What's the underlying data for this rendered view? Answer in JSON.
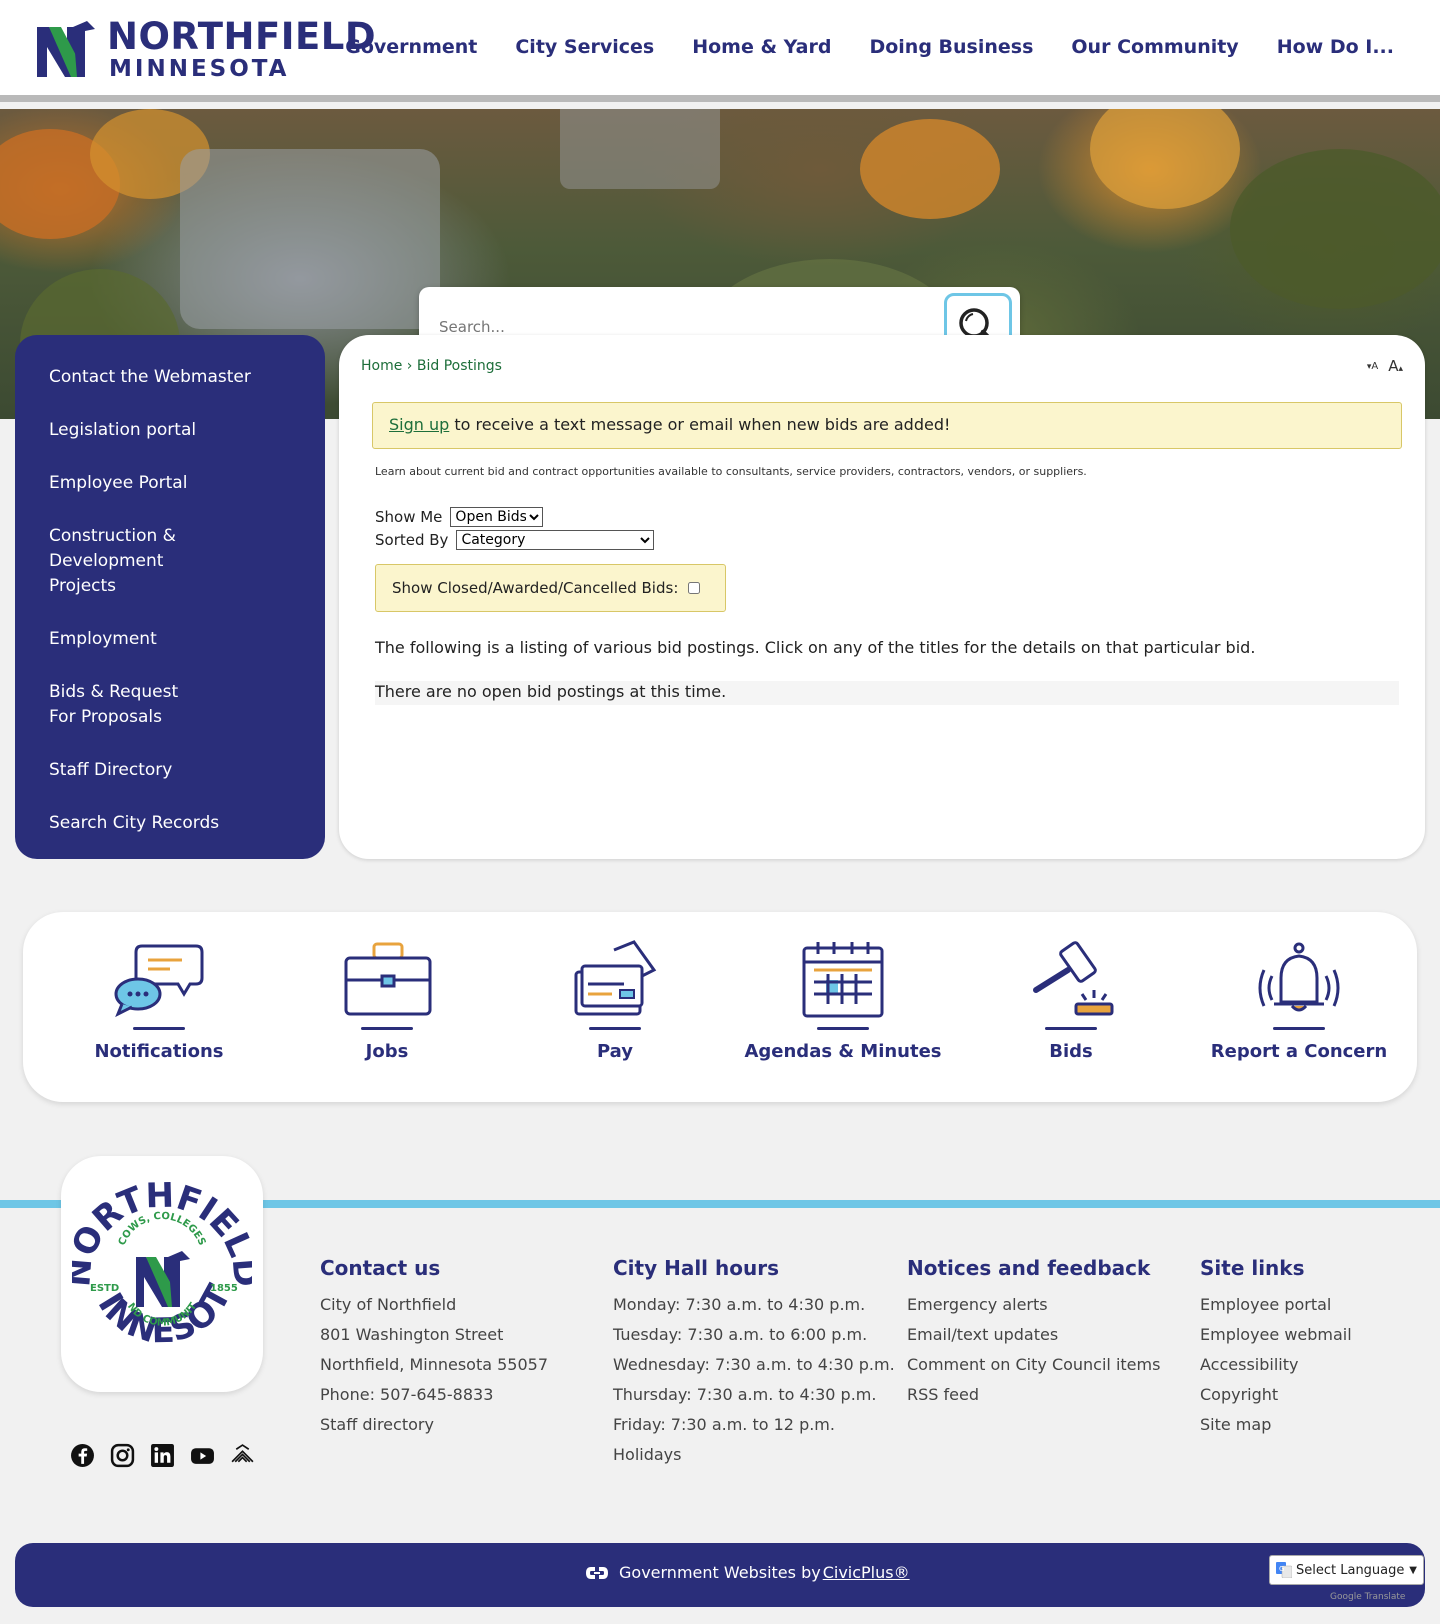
{
  "header": {
    "logo_line1": "NORTHFIELD",
    "logo_line2": "MINNESOTA",
    "nav": [
      "Government",
      "City Services",
      "Home & Yard",
      "Doing Business",
      "Our Community",
      "How Do I..."
    ]
  },
  "search": {
    "placeholder": "Search..."
  },
  "sidebar": {
    "items": [
      "Contact the Webmaster",
      "Legislation portal",
      "Employee Portal",
      "Construction & Development Projects",
      "Employment",
      "Bids & Request For Proposals",
      "Staff Directory",
      "Search City Records"
    ]
  },
  "content": {
    "breadcrumb_home": "Home",
    "breadcrumb_sep": "›",
    "breadcrumb_current": "Bid Postings",
    "font_down": "A",
    "font_up": "A",
    "alert_link": "Sign up",
    "alert_text": " to receive a text message or email when new bids are added!",
    "intro": "Learn about current bid and contract opportunities available to consultants, service providers, contractors, vendors, or suppliers.",
    "show_me_label": "Show Me",
    "show_me_value": "Open Bids",
    "sorted_by_label": "Sorted By",
    "sorted_by_value": "Category",
    "closed_label": "Show Closed/Awarded/Cancelled Bids:",
    "listing_text": "The following is a listing of various bid postings. Click on any of the titles for the details on that particular bid.",
    "empty_text": "There are no open bid postings at this time."
  },
  "quick_links": [
    "Notifications",
    "Jobs",
    "Pay",
    "Agendas & Minutes",
    "Bids",
    "Report a Concern"
  ],
  "footer": {
    "seal": {
      "top": "NORTHFIELD",
      "bottom": "MINNESOTA",
      "inner_top": "COWS, COLLEGES",
      "inner_bottom": "AND COMMUNITY",
      "left": "ESTD",
      "right": "1855"
    },
    "contact": {
      "title": "Contact us",
      "items": [
        "City of Northfield",
        "801 Washington Street",
        "Northfield, Minnesota 55057",
        "Phone: 507-645-8833",
        "Staff directory"
      ]
    },
    "hours": {
      "title": "City Hall hours",
      "items": [
        "Monday: 7:30 a.m. to 4:30 p.m.",
        "Tuesday: 7:30 a.m. to 6:00 p.m.",
        "Wednesday: 7:30 a.m. to 4:30 p.m.",
        "Thursday: 7:30 a.m. to 4:30 p.m.",
        "Friday: 7:30 a.m. to 12 p.m.",
        "Holidays"
      ]
    },
    "notices": {
      "title": "Notices and feedback",
      "items": [
        "Emergency alerts",
        "Email/text updates",
        "Comment on City Council items",
        "RSS feed"
      ]
    },
    "sitelinks": {
      "title": "Site links",
      "items": [
        "Employee portal",
        "Employee webmail",
        "Accessibility",
        "Copyright",
        "Site map"
      ]
    },
    "civic_text": "Government Websites by ",
    "civic_link": "CivicPlus®",
    "language": "Select Language",
    "google_by": "Google Translate"
  },
  "colors": {
    "brand_navy": "#2a2e7a",
    "brand_green": "#2e9a4a",
    "accent_blue": "#6ec6e6",
    "alert_yellow": "#fbf5cd",
    "accent_orange": "#e8a33d"
  }
}
